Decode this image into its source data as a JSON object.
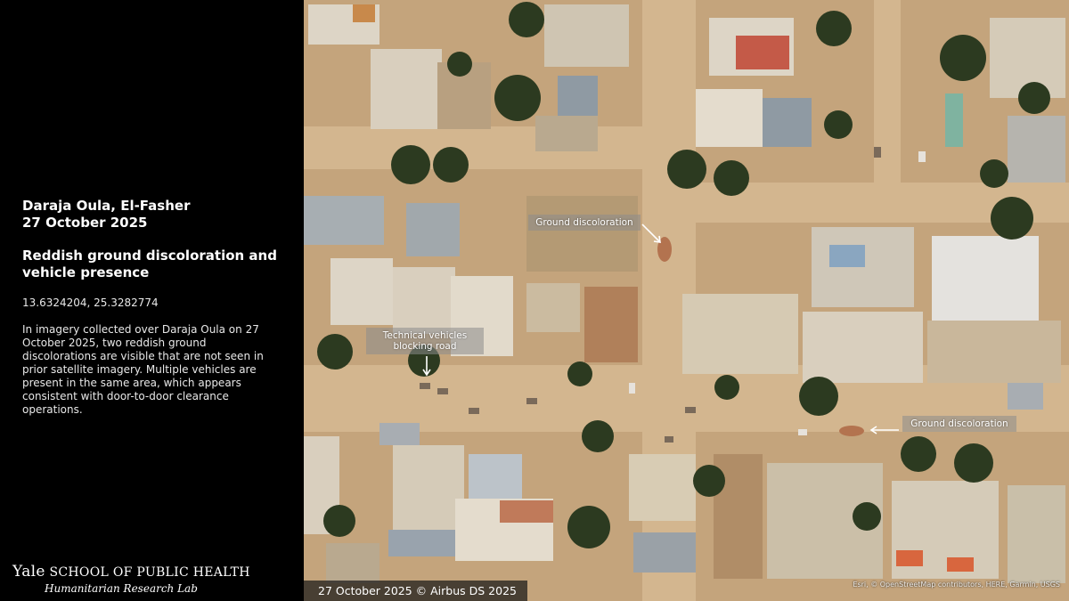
{
  "panel": {
    "place": "Daraja Oula, El-Fasher",
    "date": "27 October 2025",
    "headline": "Reddish ground discoloration and vehicle presence",
    "coordinates": "13.6324204, 25.3282774",
    "description": "In imagery collected over Daraja Oula on 27 October 2025, two reddish ground discolorations are visible that are not seen in prior satellite imagery. Multiple vehicles are present in the same area, which appears consistent with door-to-door clearance operations."
  },
  "brand": {
    "yale": "Yale",
    "school": "SCHOOL OF PUBLIC HEALTH",
    "lab": "Humanitarian Research Lab"
  },
  "annotations": {
    "ground_discoloration_1": "Ground discoloration",
    "technical_vehicles": "Technical vehicles blocking road",
    "ground_discoloration_2": "Ground discoloration"
  },
  "imagery_credit": "27 October 2025 © Airbus DS 2025",
  "attribution": "Esri, © OpenStreetMap contributors, HERE, Garmin, USGS",
  "colors": {
    "panel_bg": "#000000",
    "ground": "#c4a47c",
    "road": "#d2b48e",
    "roof_light": "#e4dccd",
    "roof_grey": "#8f9aa3",
    "tree": "#2c3a20",
    "roof_red": "#c45a48"
  }
}
